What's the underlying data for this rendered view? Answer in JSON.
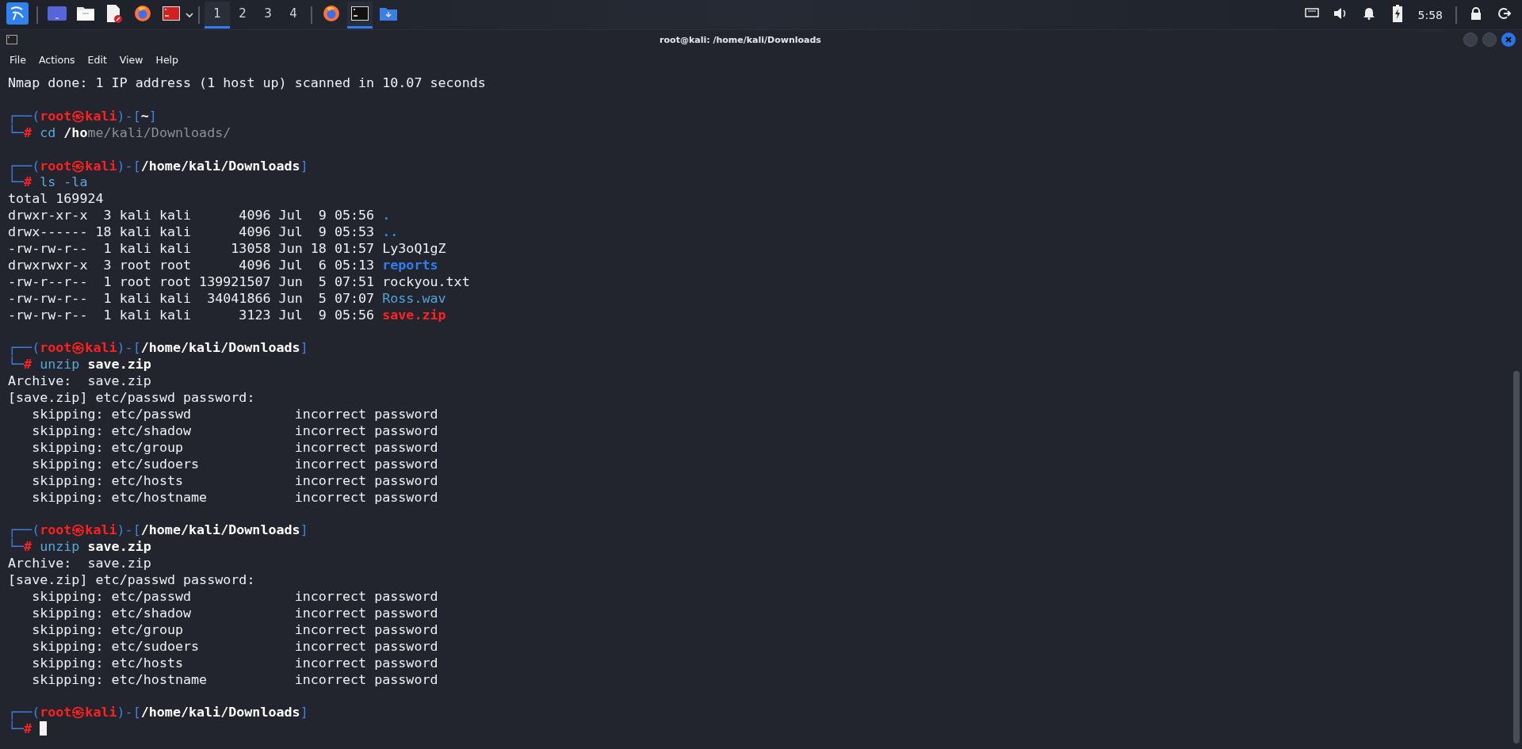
{
  "taskbar": {
    "workspaces": [
      {
        "label": "1",
        "selected": true
      },
      {
        "label": "2",
        "selected": false
      },
      {
        "label": "3",
        "selected": false
      },
      {
        "label": "4",
        "selected": false
      }
    ],
    "tasks": [
      {
        "kind": "browser",
        "selected": false
      },
      {
        "kind": "terminal",
        "selected": true
      },
      {
        "kind": "downloads",
        "selected": false
      }
    ],
    "clock": "5:58"
  },
  "window": {
    "title": "root@kali: /home/kali/Downloads",
    "menu": [
      "File",
      "Actions",
      "Edit",
      "View",
      "Help"
    ]
  },
  "terminal": {
    "blocks": [
      [
        [
          {
            "text": "Nmap done: 1 IP address (1 host up) scanned in 10.07 seconds",
            "kind": "plain"
          }
        ]
      ],
      [
        [
          {
            "text": "┌──(",
            "kind": "frame"
          },
          {
            "text": "root㉿kali",
            "kind": "user"
          },
          {
            "text": ")-[",
            "kind": "frame"
          },
          {
            "text": "~",
            "kind": "cwd"
          },
          {
            "text": "]",
            "kind": "frame"
          }
        ],
        [
          {
            "text": "└─",
            "kind": "frame"
          },
          {
            "text": "#",
            "kind": "hash"
          },
          {
            "text": " cd",
            "kind": "cmd"
          },
          {
            "text": " /ho",
            "kind": "arg"
          },
          {
            "text": "me/kali/Downloads/",
            "kind": "hint"
          }
        ]
      ],
      [
        [
          {
            "text": "┌──(",
            "kind": "frame"
          },
          {
            "text": "root㉿kali",
            "kind": "user"
          },
          {
            "text": ")-[",
            "kind": "frame"
          },
          {
            "text": "/home/kali/Downloads",
            "kind": "cwd"
          },
          {
            "text": "]",
            "kind": "frame"
          }
        ],
        [
          {
            "text": "└─",
            "kind": "frame"
          },
          {
            "text": "#",
            "kind": "hash"
          },
          {
            "text": " ls -la",
            "kind": "cmd"
          }
        ],
        [
          {
            "text": "total 169924",
            "kind": "plain"
          }
        ],
        [
          {
            "text": "drwxr-xr-x  3 kali kali      4096 Jul  9 05:56 ",
            "kind": "plain"
          },
          {
            "text": ".",
            "kind": "dot"
          }
        ],
        [
          {
            "text": "drwx------ 18 kali kali      4096 Jul  9 05:53 ",
            "kind": "plain"
          },
          {
            "text": "..",
            "kind": "dot"
          }
        ],
        [
          {
            "text": "-rw-rw-r--  1 kali kali     13058 Jun 18 01:57 Ly3oQ1gZ",
            "kind": "plain"
          }
        ],
        [
          {
            "text": "drwxrwxr-x  3 root root      4096 Jul  6 05:13 ",
            "kind": "plain"
          },
          {
            "text": "reports",
            "kind": "dir"
          }
        ],
        [
          {
            "text": "-rw-r--r--  1 root root 139921507 Jun  5 07:51 rockyou.txt",
            "kind": "plain"
          }
        ],
        [
          {
            "text": "-rw-rw-r--  1 kali kali  34041866 Jun  5 07:07 ",
            "kind": "plain"
          },
          {
            "text": "Ross.wav",
            "kind": "audio"
          }
        ],
        [
          {
            "text": "-rw-rw-r--  1 kali kali      3123 Jul  9 05:56 ",
            "kind": "plain"
          },
          {
            "text": "save.zip",
            "kind": "archive"
          }
        ]
      ],
      [
        [
          {
            "text": "┌──(",
            "kind": "frame"
          },
          {
            "text": "root㉿kali",
            "kind": "user"
          },
          {
            "text": ")-[",
            "kind": "frame"
          },
          {
            "text": "/home/kali/Downloads",
            "kind": "cwd"
          },
          {
            "text": "]",
            "kind": "frame"
          }
        ],
        [
          {
            "text": "└─",
            "kind": "frame"
          },
          {
            "text": "#",
            "kind": "hash"
          },
          {
            "text": " unzip",
            "kind": "cmd"
          },
          {
            "text": " save.zip",
            "kind": "arg"
          }
        ],
        [
          {
            "text": "Archive:  save.zip",
            "kind": "plain"
          }
        ],
        [
          {
            "text": "[save.zip] etc/passwd password:",
            "kind": "plain"
          }
        ],
        [
          {
            "text": "   skipping: etc/passwd             incorrect password",
            "kind": "plain"
          }
        ],
        [
          {
            "text": "   skipping: etc/shadow             incorrect password",
            "kind": "plain"
          }
        ],
        [
          {
            "text": "   skipping: etc/group              incorrect password",
            "kind": "plain"
          }
        ],
        [
          {
            "text": "   skipping: etc/sudoers            incorrect password",
            "kind": "plain"
          }
        ],
        [
          {
            "text": "   skipping: etc/hosts              incorrect password",
            "kind": "plain"
          }
        ],
        [
          {
            "text": "   skipping: etc/hostname           incorrect password",
            "kind": "plain"
          }
        ]
      ],
      [
        [
          {
            "text": "┌──(",
            "kind": "frame"
          },
          {
            "text": "root㉿kali",
            "kind": "user"
          },
          {
            "text": ")-[",
            "kind": "frame"
          },
          {
            "text": "/home/kali/Downloads",
            "kind": "cwd"
          },
          {
            "text": "]",
            "kind": "frame"
          }
        ],
        [
          {
            "text": "└─",
            "kind": "frame"
          },
          {
            "text": "#",
            "kind": "hash"
          },
          {
            "text": " unzip",
            "kind": "cmd"
          },
          {
            "text": " save.zip",
            "kind": "arg"
          }
        ],
        [
          {
            "text": "Archive:  save.zip",
            "kind": "plain"
          }
        ],
        [
          {
            "text": "[save.zip] etc/passwd password:",
            "kind": "plain"
          }
        ],
        [
          {
            "text": "   skipping: etc/passwd             incorrect password",
            "kind": "plain"
          }
        ],
        [
          {
            "text": "   skipping: etc/shadow             incorrect password",
            "kind": "plain"
          }
        ],
        [
          {
            "text": "   skipping: etc/group              incorrect password",
            "kind": "plain"
          }
        ],
        [
          {
            "text": "   skipping: etc/sudoers            incorrect password",
            "kind": "plain"
          }
        ],
        [
          {
            "text": "   skipping: etc/hosts              incorrect password",
            "kind": "plain"
          }
        ],
        [
          {
            "text": "   skipping: etc/hostname           incorrect password",
            "kind": "plain"
          }
        ]
      ],
      [
        [
          {
            "text": "┌──(",
            "kind": "frame"
          },
          {
            "text": "root㉿kali",
            "kind": "user"
          },
          {
            "text": ")-[",
            "kind": "frame"
          },
          {
            "text": "/home/kali/Downloads",
            "kind": "cwd"
          },
          {
            "text": "]",
            "kind": "frame"
          }
        ],
        [
          {
            "text": "└─",
            "kind": "frame"
          },
          {
            "text": "#",
            "kind": "hash"
          }
        ]
      ]
    ]
  }
}
